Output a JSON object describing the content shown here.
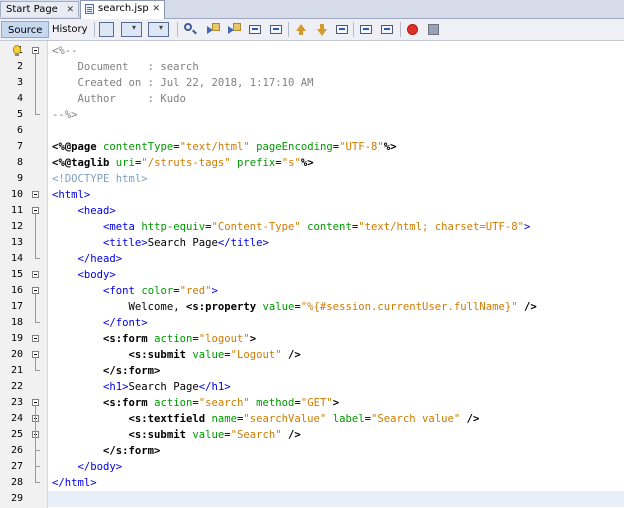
{
  "tabs": [
    {
      "label": "Start Page",
      "close": "✕",
      "active": false
    },
    {
      "label": "search.jsp",
      "close": "✕",
      "active": true
    }
  ],
  "toolbar": {
    "source_label": "Source",
    "history_label": "History",
    "icons": [
      "last-edit-icon",
      "back-icon",
      "forward-icon",
      "find-icon",
      "find-previous-icon",
      "find-next-icon",
      "toggle-highlight-icon",
      "toggle-rectangular-selection-icon",
      "previous-bookmark-icon",
      "next-bookmark-icon",
      "toggle-bookmark-icon",
      "shift-left-icon",
      "shift-right-icon",
      "start-macro-recording-icon",
      "stop-macro-recording-icon"
    ]
  },
  "lines": [
    {
      "n": "1",
      "fold": "open",
      "bulb": true,
      "tokens": [
        [
          "c-comment",
          "<%--"
        ]
      ]
    },
    {
      "n": "2",
      "tokens": [
        [
          "c-comment",
          "    Document   : search"
        ]
      ]
    },
    {
      "n": "3",
      "tokens": [
        [
          "c-comment",
          "    Created on : Jul 22, 2018, 1:17:10 AM"
        ]
      ]
    },
    {
      "n": "4",
      "tokens": [
        [
          "c-comment",
          "    Author     : Kudo"
        ]
      ]
    },
    {
      "n": "5",
      "fold": "end",
      "tokens": [
        [
          "c-comment",
          "--%>"
        ]
      ]
    },
    {
      "n": "6",
      "tokens": []
    },
    {
      "n": "7",
      "tokens": [
        [
          "c-dir",
          "<%@page"
        ],
        [
          "c-plain",
          " "
        ],
        [
          "c-attr",
          "contentType"
        ],
        [
          "c-plain",
          "="
        ],
        [
          "c-val",
          "\"text/html\""
        ],
        [
          "c-plain",
          " "
        ],
        [
          "c-attr",
          "pageEncoding"
        ],
        [
          "c-plain",
          "="
        ],
        [
          "c-val",
          "\"UTF-8\""
        ],
        [
          "c-dir",
          "%>"
        ]
      ]
    },
    {
      "n": "8",
      "tokens": [
        [
          "c-dir",
          "<%@taglib"
        ],
        [
          "c-plain",
          " "
        ],
        [
          "c-attr",
          "uri"
        ],
        [
          "c-plain",
          "="
        ],
        [
          "c-val",
          "\"/struts-tags\""
        ],
        [
          "c-plain",
          " "
        ],
        [
          "c-attr",
          "prefix"
        ],
        [
          "c-plain",
          "="
        ],
        [
          "c-val",
          "\"s\""
        ],
        [
          "c-dir",
          "%>"
        ]
      ]
    },
    {
      "n": "9",
      "tokens": [
        [
          "c-doctype",
          "<!DOCTYPE html>"
        ]
      ]
    },
    {
      "n": "10",
      "fold": "open",
      "tokens": [
        [
          "c-tag",
          "<html>"
        ]
      ]
    },
    {
      "n": "11",
      "fold": "open",
      "tokens": [
        [
          "c-plain",
          "    "
        ],
        [
          "c-tag",
          "<head>"
        ]
      ]
    },
    {
      "n": "12",
      "tokens": [
        [
          "c-plain",
          "        "
        ],
        [
          "c-tag",
          "<meta"
        ],
        [
          "c-plain",
          " "
        ],
        [
          "c-attr",
          "http-equiv"
        ],
        [
          "c-plain",
          "="
        ],
        [
          "c-val",
          "\"Content-Type\""
        ],
        [
          "c-plain",
          " "
        ],
        [
          "c-attr",
          "content"
        ],
        [
          "c-plain",
          "="
        ],
        [
          "c-val",
          "\"text/html; charset=UTF-8\""
        ],
        [
          "c-tag",
          ">"
        ]
      ]
    },
    {
      "n": "13",
      "tokens": [
        [
          "c-plain",
          "        "
        ],
        [
          "c-tag",
          "<title>"
        ],
        [
          "c-text",
          "Search Page"
        ],
        [
          "c-tag",
          "</title>"
        ]
      ]
    },
    {
      "n": "14",
      "fold": "end",
      "tokens": [
        [
          "c-plain",
          "    "
        ],
        [
          "c-tag",
          "</head>"
        ]
      ]
    },
    {
      "n": "15",
      "fold": "open",
      "tokens": [
        [
          "c-plain",
          "    "
        ],
        [
          "c-tag",
          "<body>"
        ]
      ]
    },
    {
      "n": "16",
      "fold": "open",
      "tokens": [
        [
          "c-plain",
          "        "
        ],
        [
          "c-tag",
          "<font"
        ],
        [
          "c-plain",
          " "
        ],
        [
          "c-attr",
          "color"
        ],
        [
          "c-plain",
          "="
        ],
        [
          "c-val",
          "\"red\""
        ],
        [
          "c-tag",
          ">"
        ]
      ]
    },
    {
      "n": "17",
      "tokens": [
        [
          "c-plain",
          "            "
        ],
        [
          "c-text",
          "Welcome, "
        ],
        [
          "c-dir",
          "<s:property"
        ],
        [
          "c-plain",
          " "
        ],
        [
          "c-attr",
          "value"
        ],
        [
          "c-plain",
          "="
        ],
        [
          "c-val",
          "\"%{#session.currentUser.fullName}\""
        ],
        [
          "c-plain",
          " "
        ],
        [
          "c-dir",
          "/>"
        ]
      ]
    },
    {
      "n": "18",
      "fold": "end",
      "tokens": [
        [
          "c-plain",
          "        "
        ],
        [
          "c-tag",
          "</font>"
        ]
      ]
    },
    {
      "n": "19",
      "fold": "open",
      "tokens": [
        [
          "c-plain",
          "        "
        ],
        [
          "c-dir",
          "<s:form"
        ],
        [
          "c-plain",
          " "
        ],
        [
          "c-attr",
          "action"
        ],
        [
          "c-plain",
          "="
        ],
        [
          "c-val",
          "\"logout\""
        ],
        [
          "c-dir",
          ">"
        ]
      ]
    },
    {
      "n": "20",
      "fold": "open",
      "tokens": [
        [
          "c-plain",
          "            "
        ],
        [
          "c-dir",
          "<s:submit"
        ],
        [
          "c-plain",
          " "
        ],
        [
          "c-attr",
          "value"
        ],
        [
          "c-plain",
          "="
        ],
        [
          "c-val",
          "\"Logout\""
        ],
        [
          "c-plain",
          " "
        ],
        [
          "c-dir",
          "/>"
        ]
      ]
    },
    {
      "n": "21",
      "fold": "end",
      "tokens": [
        [
          "c-plain",
          "        "
        ],
        [
          "c-dir",
          "</s:form>"
        ]
      ]
    },
    {
      "n": "22",
      "tokens": [
        [
          "c-plain",
          "        "
        ],
        [
          "c-tag",
          "<h1>"
        ],
        [
          "c-text",
          "Search Page"
        ],
        [
          "c-tag",
          "</h1>"
        ]
      ]
    },
    {
      "n": "23",
      "fold": "open",
      "tokens": [
        [
          "c-plain",
          "        "
        ],
        [
          "c-dir",
          "<s:form"
        ],
        [
          "c-plain",
          " "
        ],
        [
          "c-attr",
          "action"
        ],
        [
          "c-plain",
          "="
        ],
        [
          "c-val",
          "\"search\""
        ],
        [
          "c-plain",
          " "
        ],
        [
          "c-attr",
          "method"
        ],
        [
          "c-plain",
          "="
        ],
        [
          "c-val",
          "\"GET\""
        ],
        [
          "c-dir",
          ">"
        ]
      ]
    },
    {
      "n": "24",
      "fold": "open",
      "tokens": [
        [
          "c-plain",
          "            "
        ],
        [
          "c-dir",
          "<s:textfield"
        ],
        [
          "c-plain",
          " "
        ],
        [
          "c-attr",
          "name"
        ],
        [
          "c-plain",
          "="
        ],
        [
          "c-val",
          "\"searchValue\""
        ],
        [
          "c-plain",
          " "
        ],
        [
          "c-attr",
          "label"
        ],
        [
          "c-plain",
          "="
        ],
        [
          "c-val",
          "\"Search value\""
        ],
        [
          "c-plain",
          " "
        ],
        [
          "c-dir",
          "/>"
        ]
      ]
    },
    {
      "n": "25",
      "fold": "open",
      "tokens": [
        [
          "c-plain",
          "            "
        ],
        [
          "c-dir",
          "<s:submit"
        ],
        [
          "c-plain",
          " "
        ],
        [
          "c-attr",
          "value"
        ],
        [
          "c-plain",
          "="
        ],
        [
          "c-val",
          "\"Search\""
        ],
        [
          "c-plain",
          " "
        ],
        [
          "c-dir",
          "/>"
        ]
      ]
    },
    {
      "n": "26",
      "fold": "end",
      "tokens": [
        [
          "c-plain",
          "        "
        ],
        [
          "c-dir",
          "</s:form>"
        ]
      ]
    },
    {
      "n": "27",
      "fold": "end",
      "tokens": [
        [
          "c-plain",
          "    "
        ],
        [
          "c-tag",
          "</body>"
        ]
      ]
    },
    {
      "n": "28",
      "fold": "end",
      "tokens": [
        [
          "c-tag",
          "</html>"
        ]
      ]
    },
    {
      "n": "29",
      "current": true,
      "tokens": []
    }
  ]
}
